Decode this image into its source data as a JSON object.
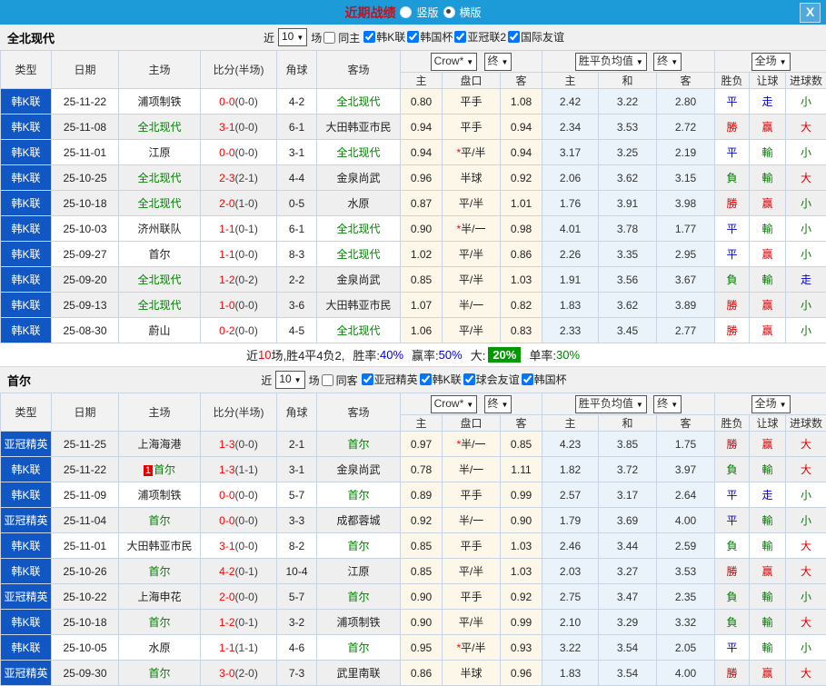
{
  "titlebar": {
    "title": "近期战绩",
    "radio_vertical": "竖版",
    "radio_horizontal": "横版",
    "selected": "横版",
    "close": "X"
  },
  "colors": {
    "titlebar_blue": "#1d9ad8",
    "league_cell_blue": "#1157c4",
    "win_red": "#dd0000",
    "lose_green": "#007a00",
    "draw_blue": "#0000dd",
    "big_rate_box_green": "#009900"
  },
  "table_header": {
    "cols": [
      "类型",
      "日期",
      "主场",
      "比分(半场)",
      "角球",
      "客场"
    ],
    "odds_source": "Crow*",
    "odds_final": "终",
    "avg_source": "胜平负均值",
    "avg_final": "终",
    "scope": "全场",
    "odds_sub": [
      "主",
      "盘口",
      "客"
    ],
    "avg_sub": [
      "主",
      "和",
      "客"
    ],
    "result_sub": [
      "胜负",
      "让球",
      "进球数"
    ]
  },
  "sections": [
    {
      "team": "全北现代",
      "filter": {
        "near": "近",
        "count": "10",
        "matches": "场",
        "same": "同主",
        "same_checked": false,
        "leagues": [
          {
            "label": "韩K联",
            "checked": true
          },
          {
            "label": "韩国杯",
            "checked": true
          },
          {
            "label": "亚冠联2",
            "checked": true
          },
          {
            "label": "国际友谊",
            "checked": true
          }
        ]
      },
      "rows": [
        {
          "league": "韩K联",
          "date": "25-11-22",
          "home": "浦项制铁",
          "home_selected": false,
          "home_badge": "",
          "score": "0-0",
          "half": "(0-0)",
          "corners": "4-2",
          "away": "全北现代",
          "away_selected": true,
          "odds_home": "0.80",
          "handicap": "平手",
          "handicap_star": false,
          "odds_away": "1.08",
          "avg_win": "2.42",
          "avg_draw": "3.22",
          "avg_lose": "2.80",
          "outcome": "平",
          "outcome_c": "blue",
          "handicap_res": "走",
          "handicap_c": "blue",
          "goals": "小",
          "goals_c": "green",
          "shaded": false
        },
        {
          "league": "韩K联",
          "date": "25-11-08",
          "home": "全北现代",
          "home_selected": true,
          "home_badge": "",
          "score": "3-1",
          "half": "(0-0)",
          "corners": "6-1",
          "away": "大田韩亚市民",
          "away_selected": false,
          "odds_home": "0.94",
          "handicap": "平手",
          "handicap_star": false,
          "odds_away": "0.94",
          "avg_win": "2.34",
          "avg_draw": "3.53",
          "avg_lose": "2.72",
          "outcome": "勝",
          "outcome_c": "red",
          "handicap_res": "赢",
          "handicap_c": "red",
          "goals": "大",
          "goals_c": "red",
          "shaded": true
        },
        {
          "league": "韩K联",
          "date": "25-11-01",
          "home": "江原",
          "home_selected": false,
          "home_badge": "",
          "score": "0-0",
          "half": "(0-0)",
          "corners": "3-1",
          "away": "全北现代",
          "away_selected": true,
          "odds_home": "0.94",
          "handicap": "平/半",
          "handicap_star": true,
          "odds_away": "0.94",
          "avg_win": "3.17",
          "avg_draw": "3.25",
          "avg_lose": "2.19",
          "outcome": "平",
          "outcome_c": "blue",
          "handicap_res": "輸",
          "handicap_c": "green",
          "goals": "小",
          "goals_c": "green",
          "shaded": false
        },
        {
          "league": "韩K联",
          "date": "25-10-25",
          "home": "全北现代",
          "home_selected": true,
          "home_badge": "",
          "score": "2-3",
          "half": "(2-1)",
          "corners": "4-4",
          "away": "金泉尚武",
          "away_selected": false,
          "odds_home": "0.96",
          "handicap": "半球",
          "handicap_star": false,
          "odds_away": "0.92",
          "avg_win": "2.06",
          "avg_draw": "3.62",
          "avg_lose": "3.15",
          "outcome": "負",
          "outcome_c": "green",
          "handicap_res": "輸",
          "handicap_c": "green",
          "goals": "大",
          "goals_c": "red",
          "shaded": true
        },
        {
          "league": "韩K联",
          "date": "25-10-18",
          "home": "全北现代",
          "home_selected": true,
          "home_badge": "",
          "score": "2-0",
          "half": "(1-0)",
          "corners": "0-5",
          "away": "水原",
          "away_selected": false,
          "odds_home": "0.87",
          "handicap": "平/半",
          "handicap_star": false,
          "odds_away": "1.01",
          "avg_win": "1.76",
          "avg_draw": "3.91",
          "avg_lose": "3.98",
          "outcome": "勝",
          "outcome_c": "red",
          "handicap_res": "赢",
          "handicap_c": "red",
          "goals": "小",
          "goals_c": "green",
          "shaded": true
        },
        {
          "league": "韩K联",
          "date": "25-10-03",
          "home": "济州联队",
          "home_selected": false,
          "home_badge": "",
          "score": "1-1",
          "half": "(0-1)",
          "corners": "6-1",
          "away": "全北现代",
          "away_selected": true,
          "odds_home": "0.90",
          "handicap": "半/一",
          "handicap_star": true,
          "odds_away": "0.98",
          "avg_win": "4.01",
          "avg_draw": "3.78",
          "avg_lose": "1.77",
          "outcome": "平",
          "outcome_c": "blue",
          "handicap_res": "輸",
          "handicap_c": "green",
          "goals": "小",
          "goals_c": "green",
          "shaded": false
        },
        {
          "league": "韩K联",
          "date": "25-09-27",
          "home": "首尔",
          "home_selected": false,
          "home_badge": "",
          "score": "1-1",
          "half": "(0-0)",
          "corners": "8-3",
          "away": "全北现代",
          "away_selected": true,
          "odds_home": "1.02",
          "handicap": "平/半",
          "handicap_star": false,
          "odds_away": "0.86",
          "avg_win": "2.26",
          "avg_draw": "3.35",
          "avg_lose": "2.95",
          "outcome": "平",
          "outcome_c": "blue",
          "handicap_res": "赢",
          "handicap_c": "red",
          "goals": "小",
          "goals_c": "green",
          "shaded": false
        },
        {
          "league": "韩K联",
          "date": "25-09-20",
          "home": "全北现代",
          "home_selected": true,
          "home_badge": "",
          "score": "1-2",
          "half": "(0-2)",
          "corners": "2-2",
          "away": "金泉尚武",
          "away_selected": false,
          "odds_home": "0.85",
          "handicap": "平/半",
          "handicap_star": false,
          "odds_away": "1.03",
          "avg_win": "1.91",
          "avg_draw": "3.56",
          "avg_lose": "3.67",
          "outcome": "負",
          "outcome_c": "green",
          "handicap_res": "輸",
          "handicap_c": "green",
          "goals": "走",
          "goals_c": "blue",
          "shaded": true
        },
        {
          "league": "韩K联",
          "date": "25-09-13",
          "home": "全北现代",
          "home_selected": true,
          "home_badge": "",
          "score": "1-0",
          "half": "(0-0)",
          "corners": "3-6",
          "away": "大田韩亚市民",
          "away_selected": false,
          "odds_home": "1.07",
          "handicap": "半/一",
          "handicap_star": false,
          "odds_away": "0.82",
          "avg_win": "1.83",
          "avg_draw": "3.62",
          "avg_lose": "3.89",
          "outcome": "勝",
          "outcome_c": "red",
          "handicap_res": "赢",
          "handicap_c": "red",
          "goals": "小",
          "goals_c": "green",
          "shaded": true
        },
        {
          "league": "韩K联",
          "date": "25-08-30",
          "home": "蔚山",
          "home_selected": false,
          "home_badge": "",
          "score": "0-2",
          "half": "(0-0)",
          "corners": "4-5",
          "away": "全北现代",
          "away_selected": true,
          "odds_home": "1.06",
          "handicap": "平/半",
          "handicap_star": false,
          "odds_away": "0.83",
          "avg_win": "2.33",
          "avg_draw": "3.45",
          "avg_lose": "2.77",
          "outcome": "勝",
          "outcome_c": "red",
          "handicap_res": "赢",
          "handicap_c": "red",
          "goals": "小",
          "goals_c": "green",
          "shaded": false
        }
      ],
      "summary": {
        "near": "近",
        "count": "10",
        "mid": "场,胜4平4负2,",
        "win_label": "胜率:",
        "win": "40%",
        "yield_label": "赢率:",
        "yield": "50%",
        "big_label": "大:",
        "big": "20%",
        "single_label": "单率:",
        "single": "30%"
      }
    },
    {
      "team": "首尔",
      "filter": {
        "near": "近",
        "count": "10",
        "matches": "场",
        "same": "同客",
        "same_checked": false,
        "leagues": [
          {
            "label": "亚冠精英",
            "checked": true
          },
          {
            "label": "韩K联",
            "checked": true
          },
          {
            "label": "球会友谊",
            "checked": true
          },
          {
            "label": "韩国杯",
            "checked": true
          }
        ]
      },
      "rows": [
        {
          "league": "亚冠精英",
          "date": "25-11-25",
          "home": "上海海港",
          "home_selected": false,
          "home_badge": "",
          "score": "1-3",
          "half": "(0-0)",
          "corners": "2-1",
          "away": "首尔",
          "away_selected": true,
          "odds_home": "0.97",
          "handicap": "半/一",
          "handicap_star": true,
          "odds_away": "0.85",
          "avg_win": "4.23",
          "avg_draw": "3.85",
          "avg_lose": "1.75",
          "outcome": "勝",
          "outcome_c": "red",
          "handicap_res": "赢",
          "handicap_c": "red",
          "goals": "大",
          "goals_c": "red",
          "shaded": true
        },
        {
          "league": "韩K联",
          "date": "25-11-22",
          "home": "首尔",
          "home_selected": true,
          "home_badge": "1",
          "score": "1-3",
          "half": "(1-1)",
          "corners": "3-1",
          "away": "金泉尚武",
          "away_selected": false,
          "odds_home": "0.78",
          "handicap": "半/一",
          "handicap_star": false,
          "odds_away": "1.11",
          "avg_win": "1.82",
          "avg_draw": "3.72",
          "avg_lose": "3.97",
          "outcome": "負",
          "outcome_c": "green",
          "handicap_res": "輸",
          "handicap_c": "green",
          "goals": "大",
          "goals_c": "red",
          "shaded": true
        },
        {
          "league": "韩K联",
          "date": "25-11-09",
          "home": "浦项制铁",
          "home_selected": false,
          "home_badge": "",
          "score": "0-0",
          "half": "(0-0)",
          "corners": "5-7",
          "away": "首尔",
          "away_selected": true,
          "odds_home": "0.89",
          "handicap": "平手",
          "handicap_star": false,
          "odds_away": "0.99",
          "avg_win": "2.57",
          "avg_draw": "3.17",
          "avg_lose": "2.64",
          "outcome": "平",
          "outcome_c": "blue",
          "handicap_res": "走",
          "handicap_c": "blue",
          "goals": "小",
          "goals_c": "green",
          "shaded": false
        },
        {
          "league": "亚冠精英",
          "date": "25-11-04",
          "home": "首尔",
          "home_selected": true,
          "home_badge": "",
          "score": "0-0",
          "half": "(0-0)",
          "corners": "3-3",
          "away": "成都蓉城",
          "away_selected": false,
          "odds_home": "0.92",
          "handicap": "半/一",
          "handicap_star": false,
          "odds_away": "0.90",
          "avg_win": "1.79",
          "avg_draw": "3.69",
          "avg_lose": "4.00",
          "outcome": "平",
          "outcome_c": "blue",
          "handicap_res": "輸",
          "handicap_c": "green",
          "goals": "小",
          "goals_c": "green",
          "shaded": true
        },
        {
          "league": "韩K联",
          "date": "25-11-01",
          "home": "大田韩亚市民",
          "home_selected": false,
          "home_badge": "",
          "score": "3-1",
          "half": "(0-0)",
          "corners": "8-2",
          "away": "首尔",
          "away_selected": true,
          "odds_home": "0.85",
          "handicap": "平手",
          "handicap_star": false,
          "odds_away": "1.03",
          "avg_win": "2.46",
          "avg_draw": "3.44",
          "avg_lose": "2.59",
          "outcome": "負",
          "outcome_c": "green",
          "handicap_res": "輸",
          "handicap_c": "green",
          "goals": "大",
          "goals_c": "red",
          "shaded": false
        },
        {
          "league": "韩K联",
          "date": "25-10-26",
          "home": "首尔",
          "home_selected": true,
          "home_badge": "",
          "score": "4-2",
          "half": "(0-1)",
          "corners": "10-4",
          "away": "江原",
          "away_selected": false,
          "odds_home": "0.85",
          "handicap": "平/半",
          "handicap_star": false,
          "odds_away": "1.03",
          "avg_win": "2.03",
          "avg_draw": "3.27",
          "avg_lose": "3.53",
          "outcome": "勝",
          "outcome_c": "red",
          "handicap_res": "赢",
          "handicap_c": "red",
          "goals": "大",
          "goals_c": "red",
          "shaded": true
        },
        {
          "league": "亚冠精英",
          "date": "25-10-22",
          "home": "上海申花",
          "home_selected": false,
          "home_badge": "",
          "score": "2-0",
          "half": "(0-0)",
          "corners": "5-7",
          "away": "首尔",
          "away_selected": true,
          "odds_home": "0.90",
          "handicap": "平手",
          "handicap_star": false,
          "odds_away": "0.92",
          "avg_win": "2.75",
          "avg_draw": "3.47",
          "avg_lose": "2.35",
          "outcome": "負",
          "outcome_c": "green",
          "handicap_res": "輸",
          "handicap_c": "green",
          "goals": "小",
          "goals_c": "green",
          "shaded": true
        },
        {
          "league": "韩K联",
          "date": "25-10-18",
          "home": "首尔",
          "home_selected": true,
          "home_badge": "",
          "score": "1-2",
          "half": "(0-1)",
          "corners": "3-2",
          "away": "浦项制铁",
          "away_selected": false,
          "odds_home": "0.90",
          "handicap": "平/半",
          "handicap_star": false,
          "odds_away": "0.99",
          "avg_win": "2.10",
          "avg_draw": "3.29",
          "avg_lose": "3.32",
          "outcome": "負",
          "outcome_c": "green",
          "handicap_res": "輸",
          "handicap_c": "green",
          "goals": "大",
          "goals_c": "red",
          "shaded": true
        },
        {
          "league": "韩K联",
          "date": "25-10-05",
          "home": "水原",
          "home_selected": false,
          "home_badge": "",
          "score": "1-1",
          "half": "(1-1)",
          "corners": "4-6",
          "away": "首尔",
          "away_selected": true,
          "odds_home": "0.95",
          "handicap": "平/半",
          "handicap_star": true,
          "odds_away": "0.93",
          "avg_win": "3.22",
          "avg_draw": "3.54",
          "avg_lose": "2.05",
          "outcome": "平",
          "outcome_c": "blue",
          "handicap_res": "輸",
          "handicap_c": "green",
          "goals": "小",
          "goals_c": "green",
          "shaded": false
        },
        {
          "league": "亚冠精英",
          "date": "25-09-30",
          "home": "首尔",
          "home_selected": true,
          "home_badge": "",
          "score": "3-0",
          "half": "(2-0)",
          "corners": "7-3",
          "away": "武里南联",
          "away_selected": false,
          "odds_home": "0.86",
          "handicap": "半球",
          "handicap_star": false,
          "odds_away": "0.96",
          "avg_win": "1.83",
          "avg_draw": "3.54",
          "avg_lose": "4.00",
          "outcome": "勝",
          "outcome_c": "red",
          "handicap_res": "赢",
          "handicap_c": "red",
          "goals": "大",
          "goals_c": "red",
          "shaded": true
        }
      ],
      "summary": null
    }
  ]
}
